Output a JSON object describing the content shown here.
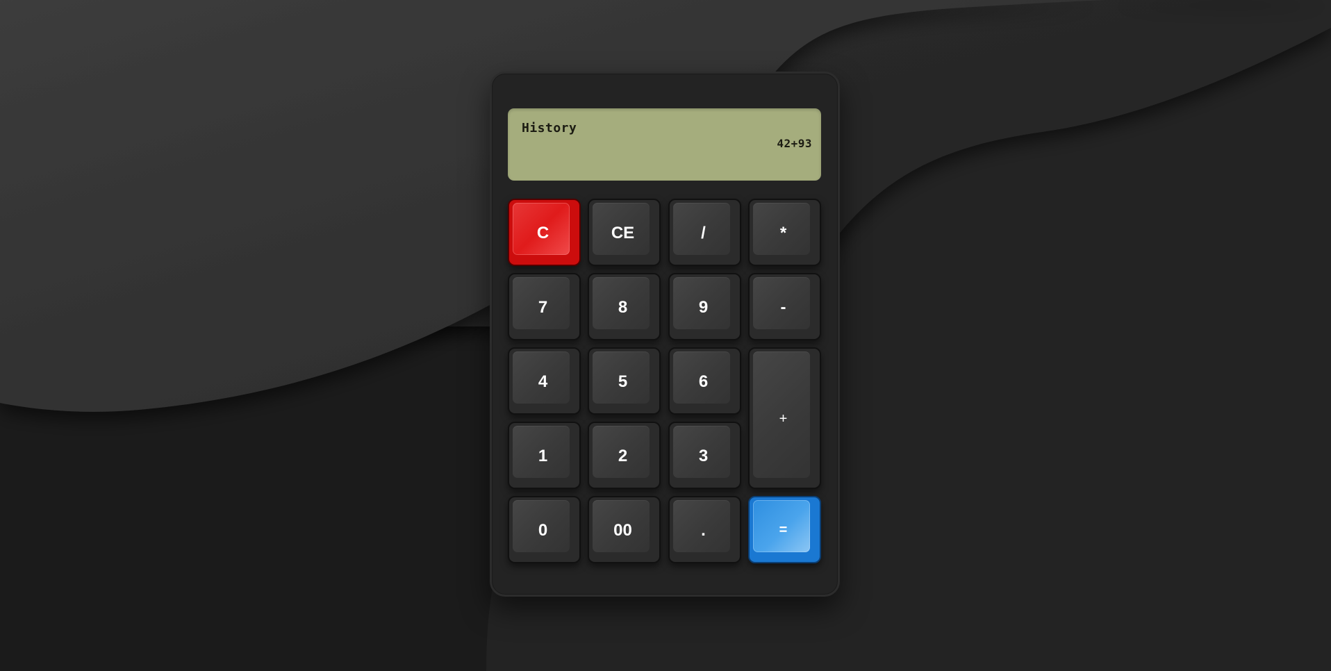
{
  "display": {
    "history_label": "History",
    "expression": "42+93"
  },
  "keys": {
    "clear": "C",
    "clear_entry": "CE",
    "divide": "/",
    "multiply": "*",
    "seven": "7",
    "eight": "8",
    "nine": "9",
    "minus": "-",
    "four": "4",
    "five": "5",
    "six": "6",
    "plus": "+",
    "one": "1",
    "two": "2",
    "three": "3",
    "zero": "0",
    "double_zero": "00",
    "decimal": ".",
    "equals": "="
  },
  "colors": {
    "background": "#1c1c1c",
    "body": "#232323",
    "display": "#a5ad7d",
    "key": "#3e3e3e",
    "clear_key": "#e01b1b",
    "equals_key": "#2f8fe0"
  }
}
